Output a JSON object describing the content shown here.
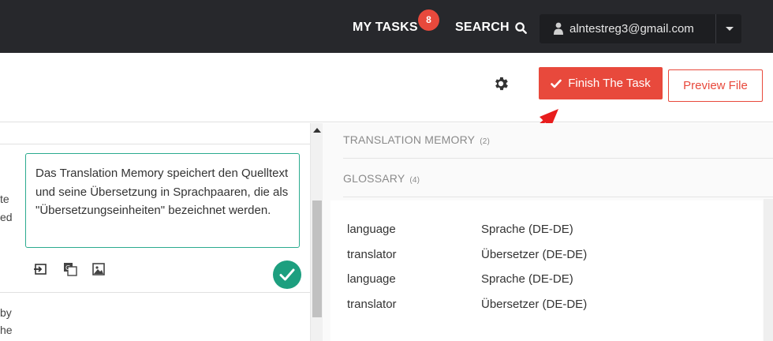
{
  "nav": {
    "my_tasks": "MY TASKS",
    "tasks_badge": "8",
    "search": "SEARCH",
    "user_email": "alntestreg3@gmail.com"
  },
  "toolbar": {
    "finish_label": "Finish The Task",
    "preview_label": "Preview File"
  },
  "editor": {
    "source_fragments": [
      "te",
      "ed",
      "by",
      "he"
    ],
    "target_text": "Das Translation Memory speichert den Quelltext und seine Übersetzung in Sprachpaaren, die als \"Übersetzungseinheiten\" bezeichnet werden."
  },
  "panel": {
    "tm_title": "TRANSLATION MEMORY",
    "tm_count": "(2)",
    "glossary_title": "GLOSSARY",
    "glossary_count": "(4)",
    "glossary": [
      {
        "term": "language",
        "translation": "Sprache (DE-DE)"
      },
      {
        "term": "translator",
        "translation": "Übersetzer (DE-DE)"
      },
      {
        "term": "language",
        "translation": "Sprache (DE-DE)"
      },
      {
        "term": "translator",
        "translation": "Übersetzer (DE-DE)"
      }
    ]
  },
  "colors": {
    "accent": "#e8493c",
    "navbar": "#27282c",
    "confirm": "#1d9f7f",
    "target_border": "#2bab8f"
  },
  "icons": [
    "search-icon",
    "user-icon",
    "chevron-down-icon",
    "gear-icon",
    "check-icon",
    "insert-source-icon",
    "machine-translate-icon",
    "image-icon",
    "confirm-check-icon",
    "arrow-up-icon"
  ]
}
